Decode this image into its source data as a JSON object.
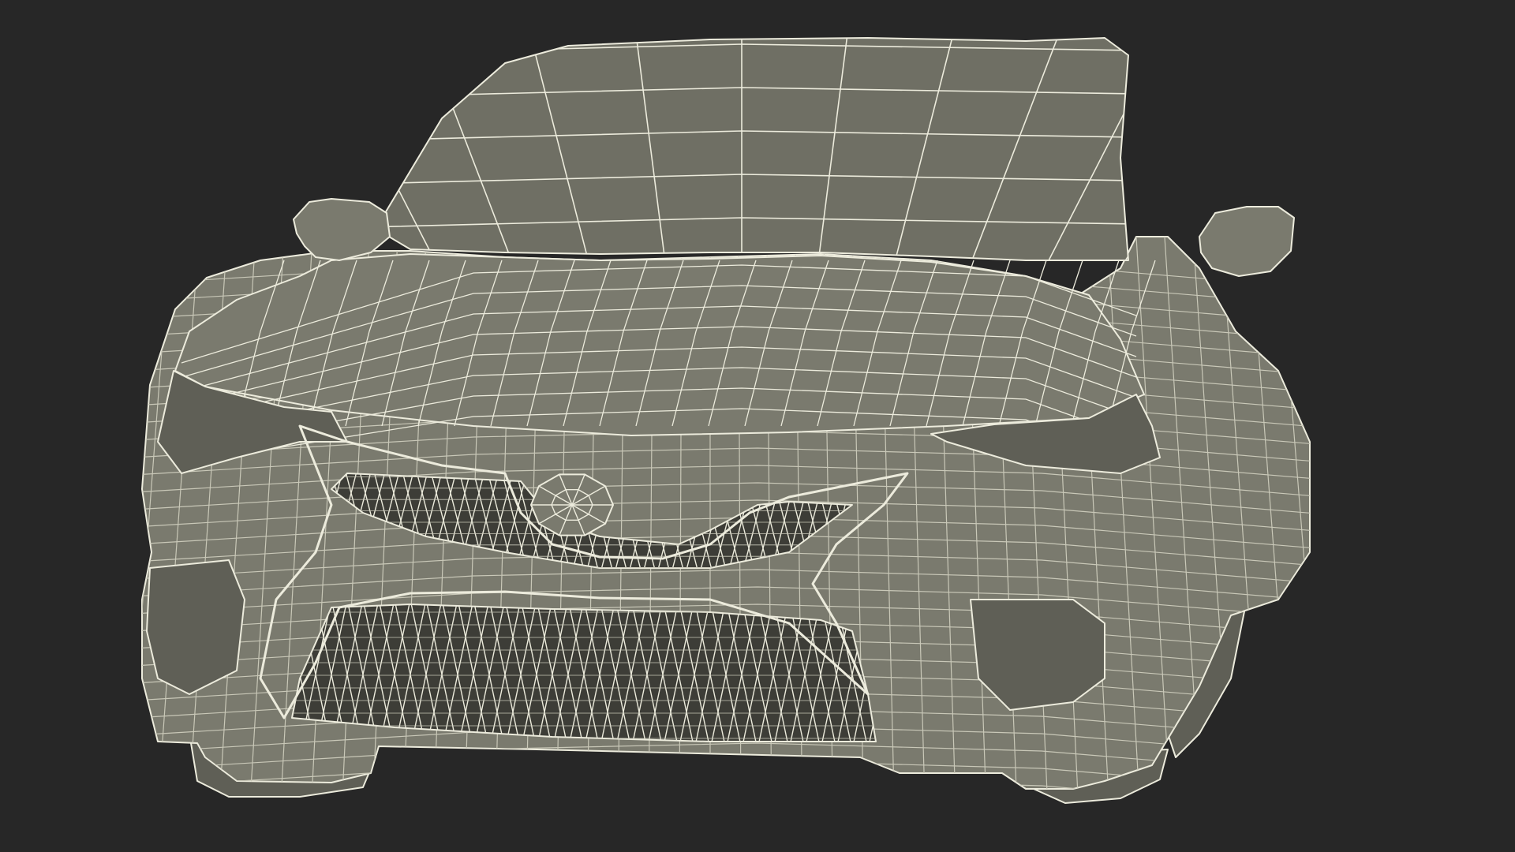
{
  "scene": {
    "subject_icon": "wireframe-sedan-front-view",
    "colors": {
      "background": "#272727",
      "body_fill": "#7a7a6e",
      "body_shadow": "#5f5f56",
      "glass_fill": "#6f6f64",
      "grille_fill": "#3d3d37",
      "wire": "#ecebdc",
      "wire_dim": "#c9c8b8"
    }
  }
}
